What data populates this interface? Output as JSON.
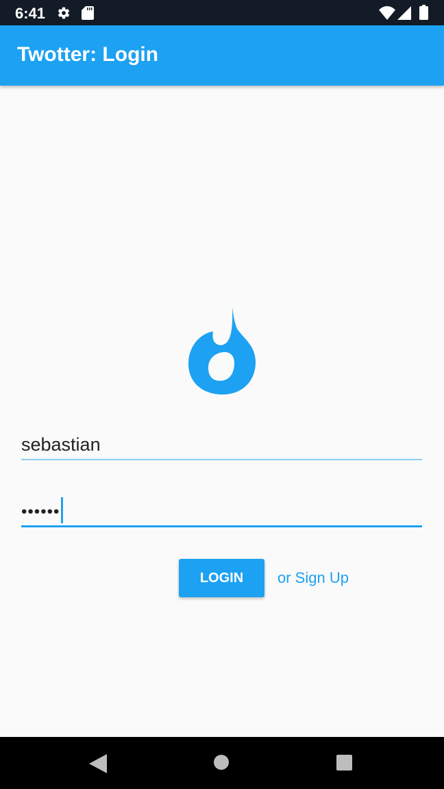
{
  "status_bar": {
    "time": "6:41",
    "icons": [
      "gear-icon",
      "sd-card-icon",
      "wifi-icon",
      "signal-icon",
      "battery-icon"
    ]
  },
  "app_bar": {
    "title": "Twotter: Login",
    "color": "#1da1f2"
  },
  "logo": {
    "icon": "flame-icon",
    "color": "#1da1f2"
  },
  "form": {
    "username_value": "sebastian",
    "password_value": "••••••"
  },
  "actions": {
    "login_label": "LOGIN",
    "signup_label": "or Sign Up"
  },
  "nav_bar": {
    "icons": [
      "back-icon",
      "home-icon",
      "recents-icon"
    ]
  }
}
